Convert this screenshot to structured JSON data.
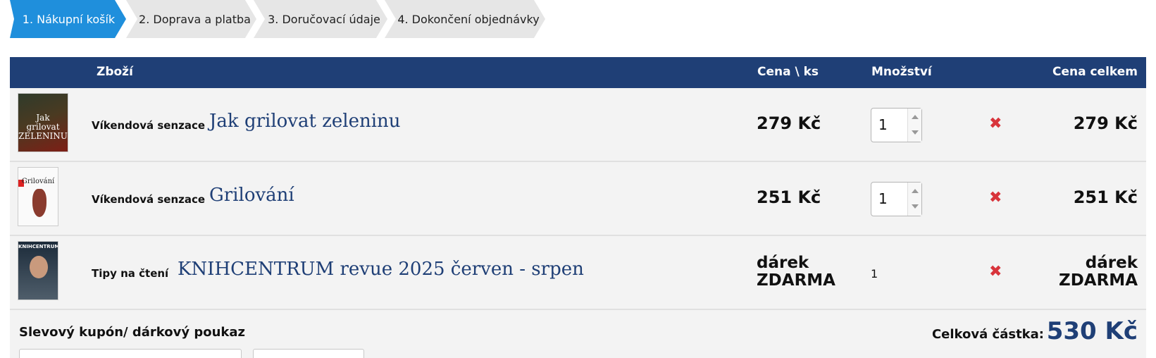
{
  "steps": [
    {
      "label": "1. Nákupní košík",
      "active": true
    },
    {
      "label": "2. Doprava a platba",
      "active": false
    },
    {
      "label": "3. Doručovací údaje",
      "active": false
    },
    {
      "label": "4. Dokončení objednávky",
      "active": false
    }
  ],
  "table": {
    "headers": {
      "goods": "Zboží",
      "unit_price": "Cena \\ ks",
      "quantity": "Množství",
      "total": "Cena celkem"
    },
    "rows": [
      {
        "category": "Víkendová senzace",
        "title": "Jak grilovat zeleninu",
        "unit_price": "279 Kč",
        "quantity": "1",
        "total": "279 Kč",
        "cover_text": "Jak grilovat ZELENINU"
      },
      {
        "category": "Víkendová senzace",
        "title": "Grilování",
        "unit_price": "251 Kč",
        "quantity": "1",
        "total": "251 Kč",
        "cover_text": "Grilování"
      },
      {
        "category": "Tipy na čtení",
        "title": "KNIHCENTRUM revue 2025 červen - srpen",
        "unit_price_line1": "dárek",
        "unit_price_line2": "ZDARMA",
        "quantity": "1",
        "total_line1": "dárek",
        "total_line2": "ZDARMA",
        "cover_text": "KNIHCENTRUM"
      }
    ]
  },
  "remove_icon": "remove-x-icon",
  "coupon": {
    "label": "Slevový kupón/ dárkový poukaz"
  },
  "summary": {
    "label": "Celková částka:",
    "value": "530 Kč"
  },
  "colors": {
    "accent": "#1f8fdc",
    "header": "#1f3f76",
    "remove": "#d8343b"
  }
}
